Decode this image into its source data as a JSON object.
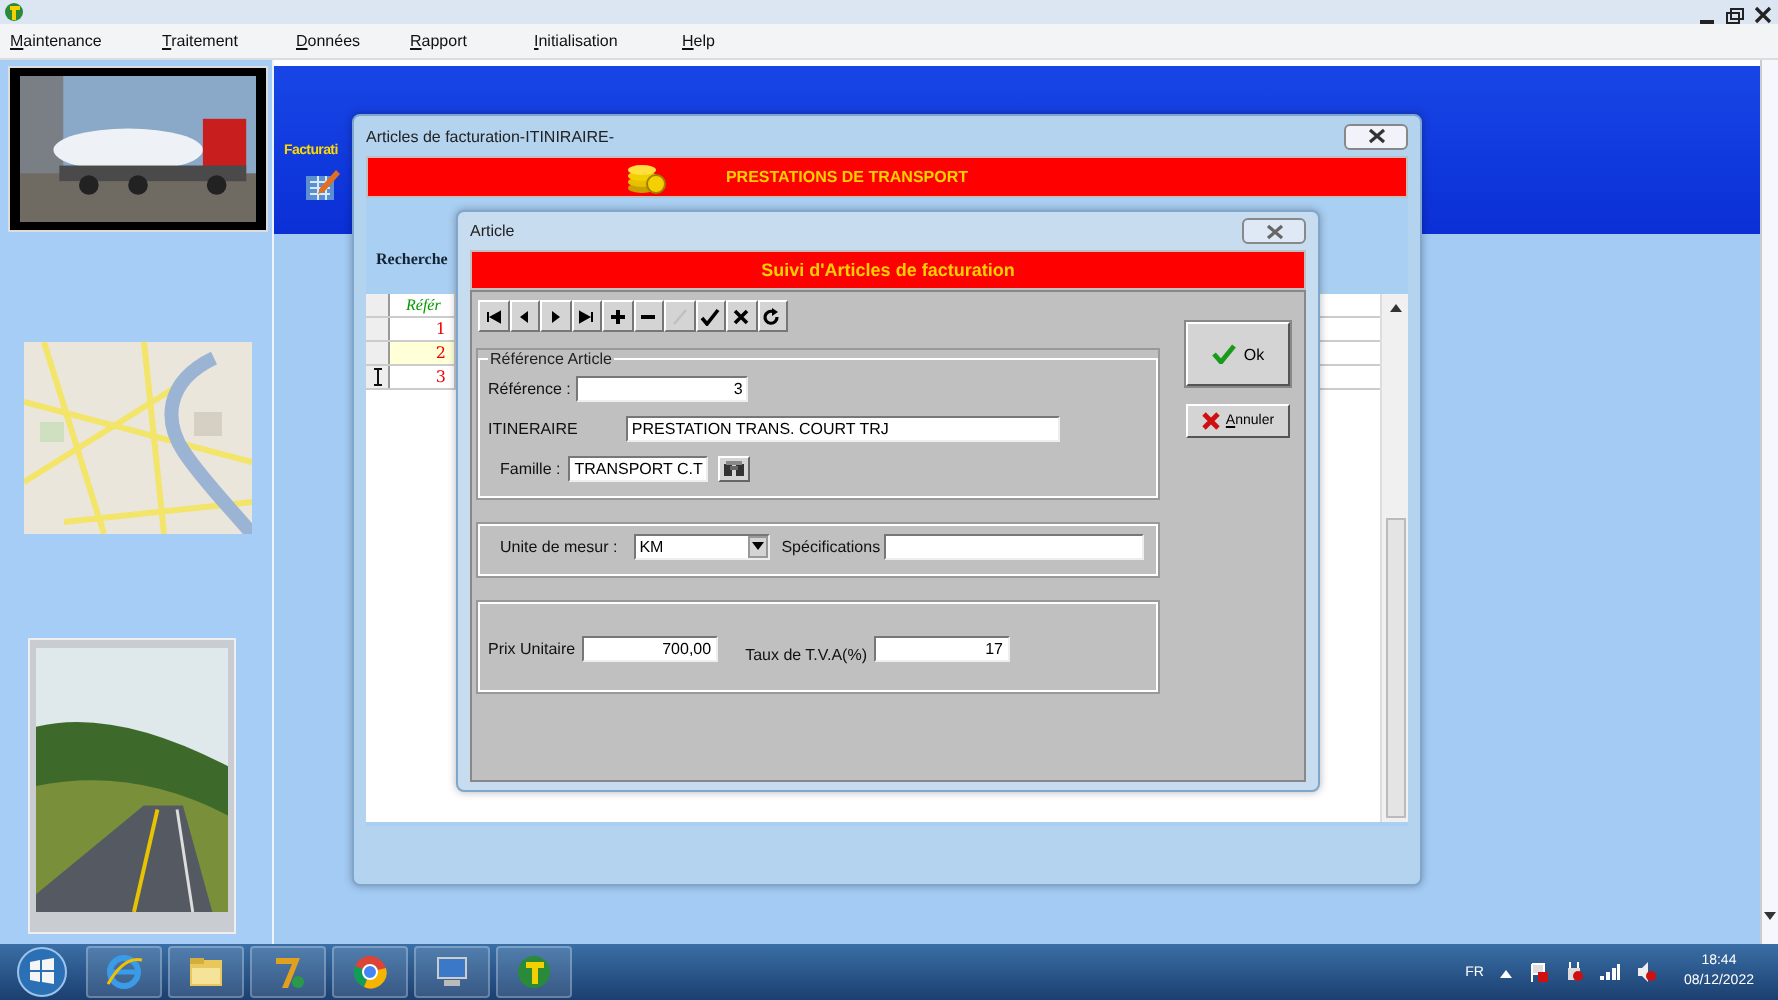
{
  "menu": [
    {
      "label": "Maintenance"
    },
    {
      "label": "Traitement"
    },
    {
      "label": "Données"
    },
    {
      "label": "Rapport"
    },
    {
      "label": "Initialisation"
    },
    {
      "label": "Help"
    }
  ],
  "desktop": {
    "module_label": "Facturati"
  },
  "outer_window": {
    "title": "Articles de facturation-ITINIRAIRE-",
    "banner": "PRESTATIONS DE TRANSPORT",
    "search_label": "Recherche",
    "grid": {
      "columns": [
        "Référ"
      ],
      "rows": [
        {
          "cells": [
            "1"
          ],
          "selected": false,
          "current": false
        },
        {
          "cells": [
            "2"
          ],
          "selected": true,
          "current": false
        },
        {
          "cells": [
            "3"
          ],
          "selected": false,
          "current": true
        }
      ]
    }
  },
  "article_window": {
    "title": "Article",
    "banner": "Suivi d'Articles de facturation",
    "toolbar": [
      {
        "kind": "first",
        "disabled": false
      },
      {
        "kind": "prev",
        "disabled": false
      },
      {
        "kind": "next",
        "disabled": false
      },
      {
        "kind": "last",
        "disabled": false
      },
      {
        "kind": "add",
        "disabled": false
      },
      {
        "kind": "delete",
        "disabled": false
      },
      {
        "kind": "edit",
        "disabled": true
      },
      {
        "kind": "post",
        "disabled": false
      },
      {
        "kind": "cancel",
        "disabled": false
      },
      {
        "kind": "refresh",
        "disabled": false
      }
    ],
    "groups": [
      {
        "legend": "Référence Article",
        "rows": [
          {
            "fields": [
              {
                "kind": "number",
                "label": "Référence :",
                "value": "3"
              }
            ]
          },
          {
            "fields": [
              {
                "kind": "text",
                "label": "ITINERAIRE",
                "value": "PRESTATION TRANS. COURT TRJ"
              }
            ]
          },
          {
            "fields": [
              {
                "kind": "text",
                "label": "Famille :",
                "value": "TRANSPORT C.T",
                "lookup": true
              }
            ]
          }
        ]
      },
      {
        "rows": [
          {
            "fields": [
              {
                "kind": "combo",
                "label": "Unite de mesur :",
                "value": "KM"
              },
              {
                "kind": "text",
                "label": "Spécifications"
              }
            ]
          }
        ]
      },
      {
        "rows": [
          {
            "fields": [
              {
                "kind": "number",
                "label": "Prix Unitaire",
                "value": "700,00"
              },
              {
                "kind": "number",
                "label": "Taux de T.V.A(%)",
                "value": "17"
              }
            ]
          }
        ]
      }
    ],
    "buttons": [
      {
        "kind": "ok",
        "label": "Ok"
      },
      {
        "kind": "cancel",
        "label": "Annuler"
      }
    ]
  },
  "taskbar": {
    "apps": [
      {
        "kind": "ie"
      },
      {
        "kind": "folder"
      },
      {
        "kind": "seven"
      },
      {
        "kind": "chrome"
      },
      {
        "kind": "monitor"
      },
      {
        "kind": "app"
      }
    ],
    "tray": {
      "language": "FR",
      "time": "18:44",
      "date": "08/12/2022"
    }
  }
}
